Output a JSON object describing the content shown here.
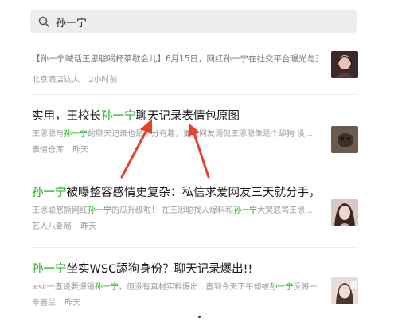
{
  "search": {
    "query": "孙一宁"
  },
  "results": [
    {
      "title_parts": [
        "【孙一宁喊话王思聪喝杯茶歇会儿】6月15日，网红孙一宁在社交平台曝光与王..."
      ],
      "snippet": "",
      "source": "北京酒店达人",
      "time": "2小时前"
    },
    {
      "title_pre": "实用，王校长",
      "title_hl": "孙一宁",
      "title_post": "聊天记录表情包原图",
      "snippet_pre": "王思聪与",
      "snippet_hl": "孙一宁",
      "snippet_post": "的聊天记录也是十分有趣，更让网友调侃王思聪像是个舔狗 没...",
      "source": "表情仓库",
      "time": "昨天"
    },
    {
      "title_hl": "孙一宁",
      "title_post": "被曝整容感情史复杂：私信求爱网友三天就分手，...",
      "snippet_pre": "王思聪怒撕网红",
      "snippet_hl": "孙一宁",
      "snippet_mid": "的瓜升级啦！ 在王思聪找人爆料和",
      "snippet_hl2": "孙一宁",
      "snippet_post": "大哭怒骂王思...",
      "source": "艺人八卦局",
      "time": "昨天"
    },
    {
      "title_hl": "孙一宁",
      "title_post": "坐实WSC舔狗身份？聊天记录爆出!!",
      "snippet_pre": "wsc一直说要爆锤",
      "snippet_hl": "孙一宁",
      "snippet_mid": "，但没有真材实料爆出...直到今天下午却被",
      "snippet_hl2": "孙一宁",
      "snippet_post": "反将一军。",
      "source": "辛善兰",
      "time": "昨天"
    }
  ],
  "colors": {
    "highlight": "#1aad19",
    "arrow": "#e8402a"
  }
}
